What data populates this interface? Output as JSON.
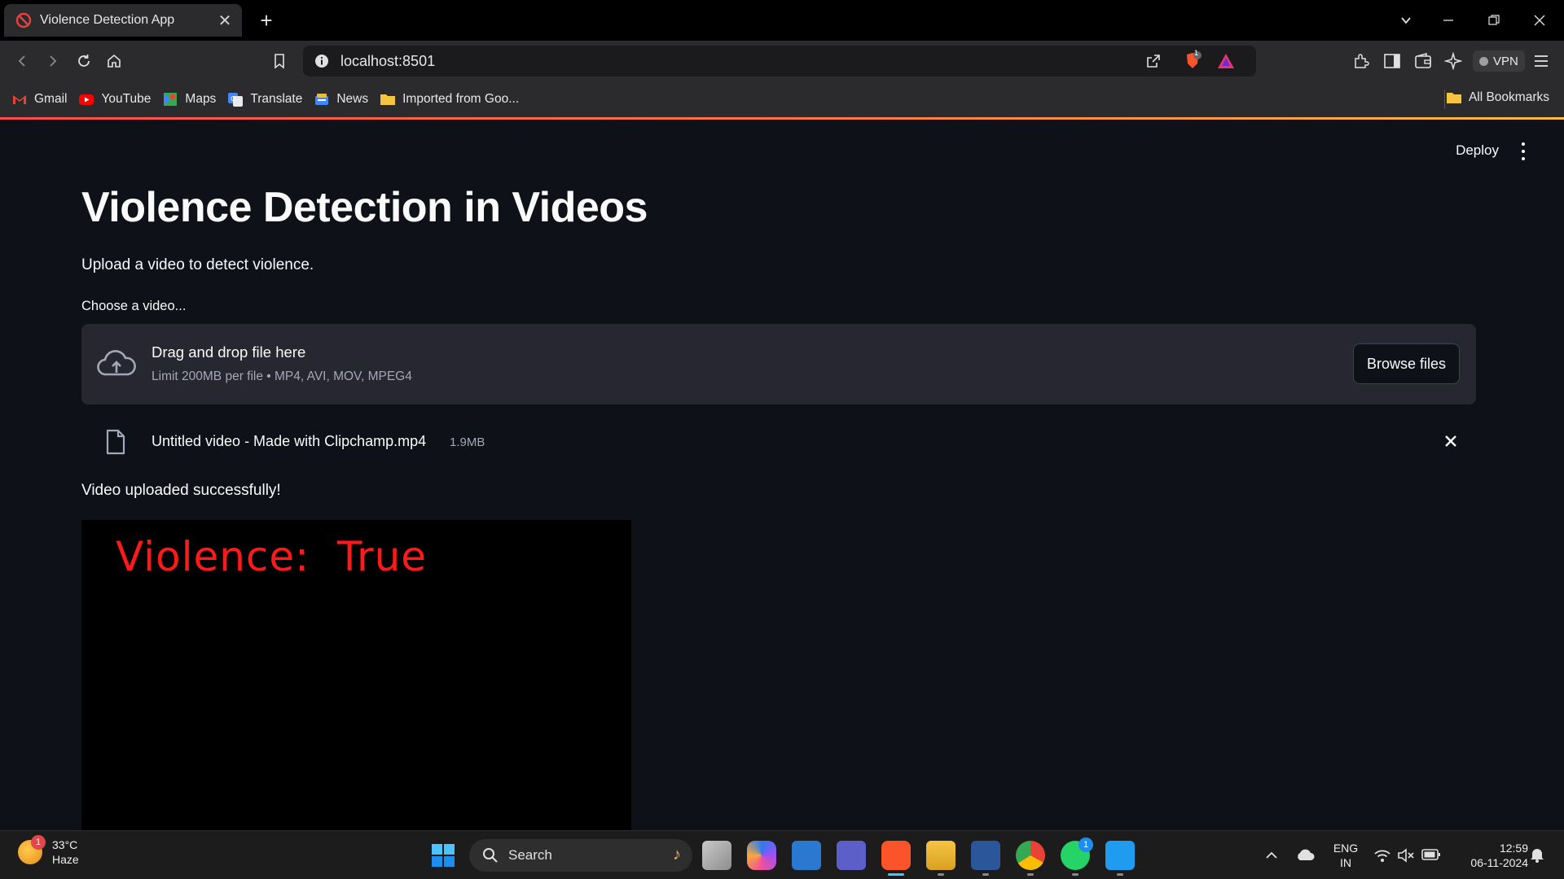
{
  "browser": {
    "tab_title": "Violence Detection App",
    "url": "localhost:8501",
    "vpn_label": "VPN",
    "shield_badge": "1"
  },
  "bookmarks": [
    {
      "label": "Gmail",
      "icon": "gmail-icon"
    },
    {
      "label": "YouTube",
      "icon": "youtube-icon"
    },
    {
      "label": "Maps",
      "icon": "maps-icon"
    },
    {
      "label": "Translate",
      "icon": "translate-icon"
    },
    {
      "label": "News",
      "icon": "news-icon"
    },
    {
      "label": "Imported from Goo...",
      "icon": "folder-icon"
    }
  ],
  "all_bookmarks": "All Bookmarks",
  "app": {
    "deploy_label": "Deploy",
    "title": "Violence Detection in Videos",
    "subtitle": "Upload a video to detect violence.",
    "uploader_label": "Choose a video...",
    "dropzone_title": "Drag and drop file here",
    "dropzone_limit": "Limit 200MB per file • MP4, AVI, MOV, MPEG4",
    "browse_label": "Browse files",
    "file_name": "Untitled video - Made with Clipchamp.mp4",
    "file_size": "1.9MB",
    "success_message": "Video uploaded successfully!",
    "video_overlay": "Violence:  True",
    "colors": {
      "background": "#0e1117",
      "dropzone": "#262730",
      "overlay_text": "#ff1a1a"
    }
  },
  "taskbar": {
    "weather_temp": "33°C",
    "weather_desc": "Haze",
    "weather_badge": "1",
    "search_label": "Search",
    "lang_1": "ENG",
    "lang_2": "IN",
    "time": "12:59",
    "date": "06-11-2024",
    "whatsapp_badge": "1"
  }
}
